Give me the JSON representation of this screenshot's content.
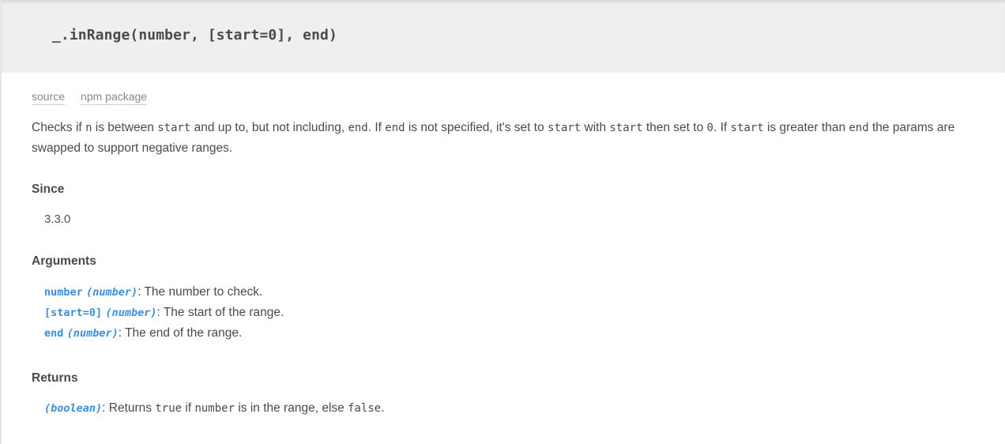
{
  "header": {
    "signature": "_.inRange(number, [start=0], end)"
  },
  "links": {
    "source": "source",
    "npm": "npm package"
  },
  "description": {
    "t1": "Checks if ",
    "c1": "n",
    "t2": " is between ",
    "c2": "start",
    "t3": " and up to, but not including, ",
    "c3": "end",
    "t4": ". If ",
    "c4": "end",
    "t5": " is not specified, it's set to ",
    "c5": "start",
    "t6": " with ",
    "c6": "start",
    "t7": " then set to ",
    "c7": "0",
    "t8": ". If ",
    "c8": "start",
    "t9": " is greater than ",
    "c9": "end",
    "t10": " the params are swapped to support negative ranges."
  },
  "since": {
    "heading": "Since",
    "version": "3.3.0"
  },
  "arguments": {
    "heading": "Arguments",
    "items": [
      {
        "name": "number",
        "type": "(number)",
        "desc": ": The number to check."
      },
      {
        "name": "[start=0]",
        "type": "(number)",
        "desc": ": The start of the range."
      },
      {
        "name": "end",
        "type": "(number)",
        "desc": ": The end of the range."
      }
    ]
  },
  "returns": {
    "heading": "Returns",
    "type": "(boolean)",
    "t1": ": Returns ",
    "c1": "true",
    "t2": " if ",
    "c2": "number",
    "t3": " is in the range, else ",
    "c3": "false",
    "t4": "."
  }
}
